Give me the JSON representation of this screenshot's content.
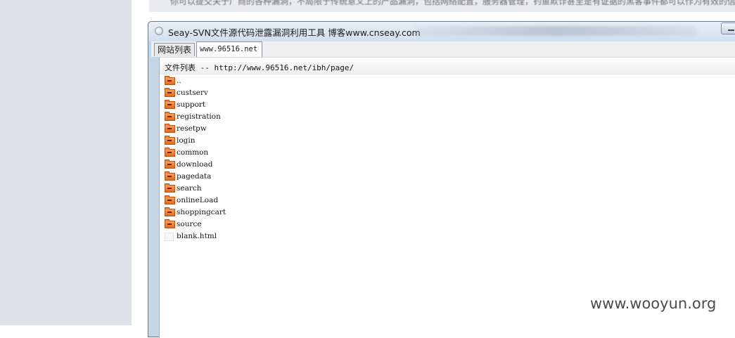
{
  "background_text": "你可以提交关于厂商的各种漏洞，不局限于传统意义上的产品漏洞，包括网络配置，服务器管理，钓鱼欺诈甚至是有证据的黑客事件都可以作为有效的信",
  "window": {
    "title": "Seay-SVN文件源代码泄露漏洞利用工具  博客www.cnseay.com"
  },
  "tabs": [
    {
      "label": "网站列表"
    },
    {
      "label": "www.96516.net"
    }
  ],
  "file_list": {
    "header": "文件列表 -- http://www.96516.net/ibh/page/",
    "items": [
      {
        "name": "..",
        "type": "folder"
      },
      {
        "name": "custserv",
        "type": "folder"
      },
      {
        "name": "support",
        "type": "folder"
      },
      {
        "name": "registration",
        "type": "folder"
      },
      {
        "name": "resetpw",
        "type": "folder"
      },
      {
        "name": "login",
        "type": "folder"
      },
      {
        "name": "common",
        "type": "folder"
      },
      {
        "name": "download",
        "type": "folder"
      },
      {
        "name": "pagedata",
        "type": "folder"
      },
      {
        "name": "search",
        "type": "folder"
      },
      {
        "name": "onlineLoad",
        "type": "folder"
      },
      {
        "name": "shoppingcart",
        "type": "folder"
      },
      {
        "name": "source",
        "type": "folder"
      },
      {
        "name": "blank.html",
        "type": "file"
      }
    ]
  },
  "watermark": "www.wooyun.org",
  "colors": {
    "folder": "#e8782a",
    "titlebar": "#dbe6f3",
    "sidebar": "#dfe2e6"
  }
}
